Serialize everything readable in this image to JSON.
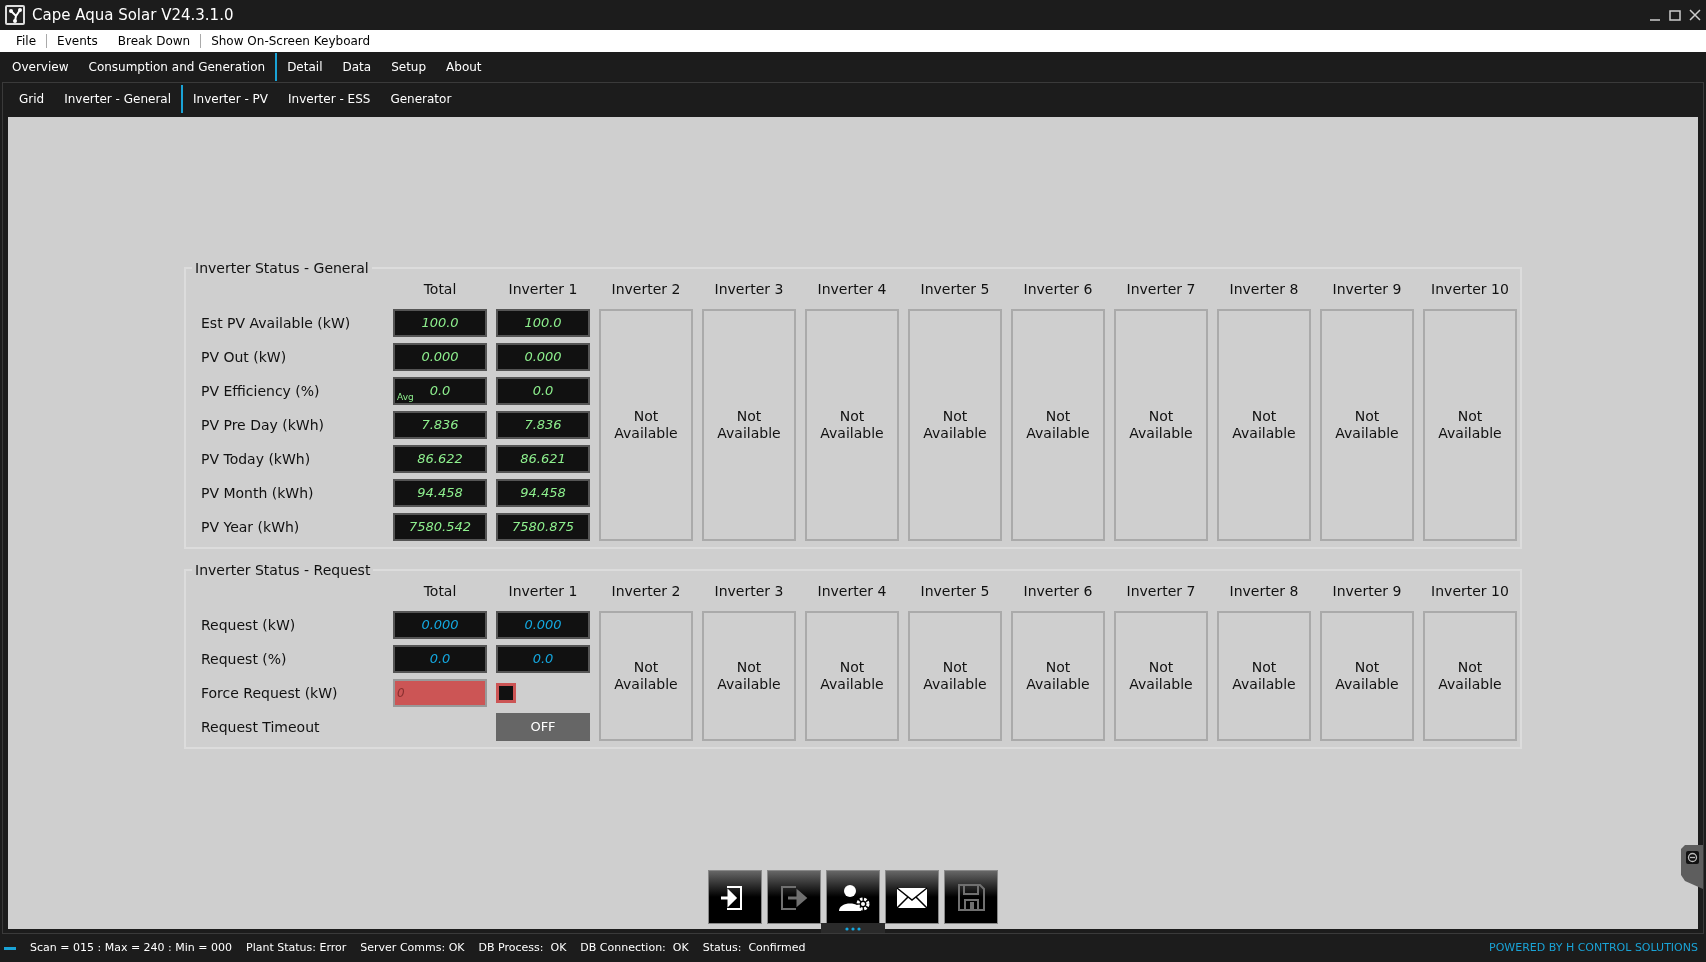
{
  "window": {
    "title": "Cape Aqua Solar V24.3.1.0"
  },
  "menu": [
    {
      "label": "File"
    },
    {
      "label": "Events"
    },
    {
      "label": "Break Down"
    },
    {
      "label": "Show On-Screen Keyboard"
    }
  ],
  "main_tabs": [
    {
      "label": "Overview",
      "selected": false
    },
    {
      "label": "Consumption and Generation",
      "selected": true
    },
    {
      "label": "Detail",
      "selected": false
    },
    {
      "label": "Data",
      "selected": false
    },
    {
      "label": "Setup",
      "selected": false
    },
    {
      "label": "About",
      "selected": false
    }
  ],
  "sub_tabs": [
    {
      "label": "Grid",
      "selected": false
    },
    {
      "label": "Inverter - General",
      "selected": true
    },
    {
      "label": "Inverter - PV",
      "selected": false
    },
    {
      "label": "Inverter - ESS",
      "selected": false
    },
    {
      "label": "Generator",
      "selected": false
    }
  ],
  "general": {
    "title": "Inverter Status - General",
    "columns": [
      {
        "header": "Total"
      },
      {
        "header": "Inverter 1"
      },
      {
        "header": "Inverter 2",
        "status": "Not Available"
      },
      {
        "header": "Inverter 3",
        "status": "Not Available"
      },
      {
        "header": "Inverter 4",
        "status": "Not Available"
      },
      {
        "header": "Inverter 5",
        "status": "Not Available"
      },
      {
        "header": "Inverter 6",
        "status": "Not Available"
      },
      {
        "header": "Inverter 7",
        "status": "Not Available"
      },
      {
        "header": "Inverter 8",
        "status": "Not Available"
      },
      {
        "header": "Inverter 9",
        "status": "Not Available"
      },
      {
        "header": "Inverter 10",
        "status": "Not Available"
      }
    ],
    "rows": [
      {
        "label": "Est PV Available (kW)",
        "values": [
          "100.0",
          "100.0"
        ]
      },
      {
        "label": "PV Out (kW)",
        "values": [
          "0.000",
          "0.000"
        ]
      },
      {
        "label": "PV Efficiency (%)",
        "values": [
          "0.0",
          "0.0"
        ],
        "total_tag": "Avg"
      },
      {
        "label": "PV Pre Day (kWh)",
        "values": [
          "7.836",
          "7.836"
        ]
      },
      {
        "label": "PV Today (kWh)",
        "values": [
          "86.622",
          "86.621"
        ]
      },
      {
        "label": "PV Month (kWh)",
        "values": [
          "94.458",
          "94.458"
        ]
      },
      {
        "label": "PV Year (kWh)",
        "values": [
          "7580.542",
          "7580.875"
        ]
      }
    ]
  },
  "request": {
    "title": "Inverter Status - Request",
    "columns": [
      {
        "header": "Total"
      },
      {
        "header": "Inverter 1"
      },
      {
        "header": "Inverter 2",
        "status": "Not Available"
      },
      {
        "header": "Inverter 3",
        "status": "Not Available"
      },
      {
        "header": "Inverter 4",
        "status": "Not Available"
      },
      {
        "header": "Inverter 5",
        "status": "Not Available"
      },
      {
        "header": "Inverter 6",
        "status": "Not Available"
      },
      {
        "header": "Inverter 7",
        "status": "Not Available"
      },
      {
        "header": "Inverter 8",
        "status": "Not Available"
      },
      {
        "header": "Inverter 9",
        "status": "Not Available"
      },
      {
        "header": "Inverter 10",
        "status": "Not Available"
      }
    ],
    "rows": [
      {
        "kind": "readout",
        "label": "Request (kW)",
        "values": [
          "0.000",
          "0.000"
        ]
      },
      {
        "kind": "readout",
        "label": "Request (%)",
        "values": [
          "0.0",
          "0.0"
        ]
      },
      {
        "kind": "force",
        "label": "Force Request (kW)",
        "value": "0",
        "checked": false
      },
      {
        "kind": "toggle",
        "label": "Request Timeout",
        "value": "OFF"
      }
    ]
  },
  "toolbar": [
    {
      "kind": "login",
      "disabled": false
    },
    {
      "kind": "logout",
      "disabled": true
    },
    {
      "kind": "user-settings",
      "disabled": false
    },
    {
      "kind": "mail",
      "disabled": false
    },
    {
      "kind": "save",
      "disabled": true
    }
  ],
  "status_bar": {
    "items": [
      "Scan = 015 : Max = 240 : Min = 000",
      "Plant Status: Error",
      "Server Comms: OK",
      "DB Process:  OK",
      "DB Connection:  OK",
      "Status:  Confirmed"
    ],
    "credit": "POWERED BY H CONTROL SOLUTIONS"
  }
}
